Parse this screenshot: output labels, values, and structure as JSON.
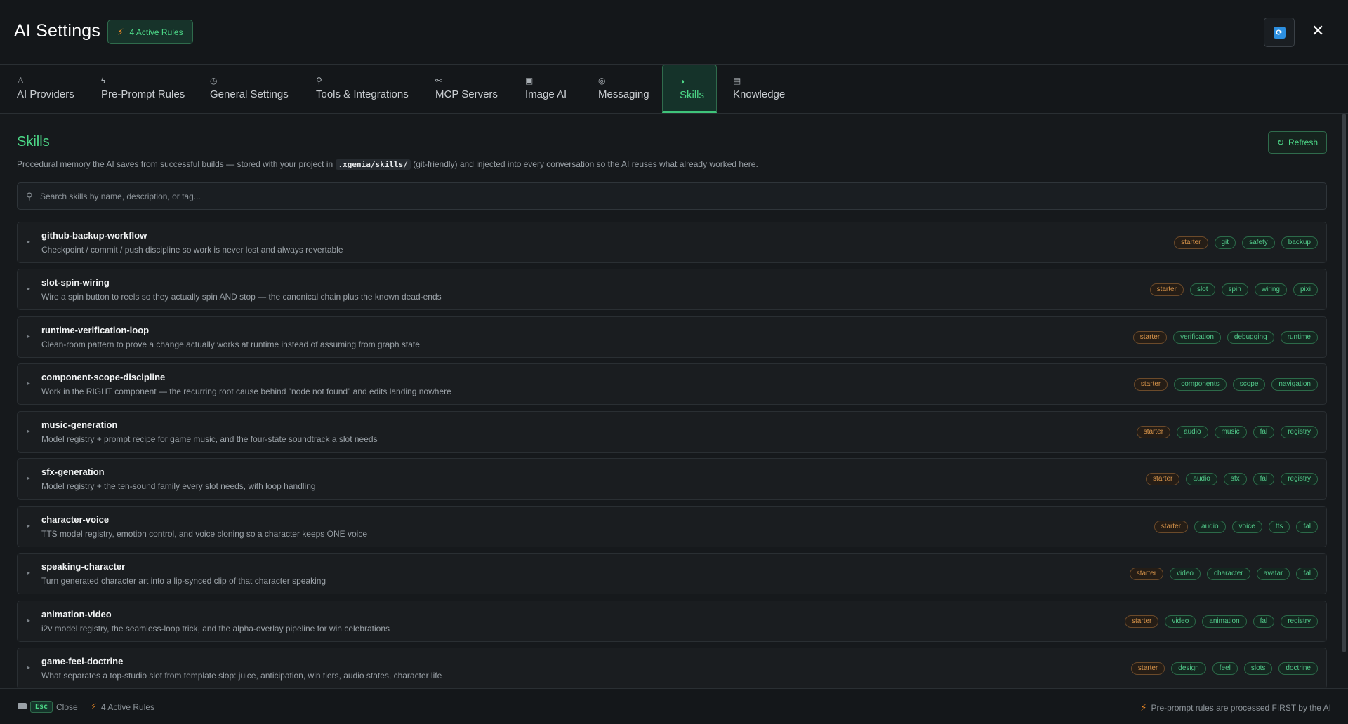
{
  "header": {
    "title": "AI Settings",
    "active_rules": "4 Active Rules",
    "sync_icon": "sync-icon",
    "close_icon": "close-icon"
  },
  "tabs": [
    {
      "label": "AI Providers",
      "icon": "user-icon"
    },
    {
      "label": "Pre-Prompt Rules",
      "icon": "bolt-icon"
    },
    {
      "label": "General Settings",
      "icon": "gear-icon"
    },
    {
      "label": "Tools & Integrations",
      "icon": "wrench-icon"
    },
    {
      "label": "MCP Servers",
      "icon": "plug-icon"
    },
    {
      "label": "Image AI",
      "icon": "image-icon"
    },
    {
      "label": "Messaging",
      "icon": "chat-icon"
    },
    {
      "label": "Skills",
      "icon": "brain-icon",
      "active": true
    },
    {
      "label": "Knowledge",
      "icon": "book-icon"
    }
  ],
  "skills_page": {
    "title": "Skills",
    "refresh_label": "Refresh",
    "desc_before": "Procedural memory the AI saves from successful builds — stored with your project in ",
    "desc_code": ".xgenia/skills/",
    "desc_after": " (git-friendly) and injected into every conversation so the AI reuses what already worked here.",
    "search_placeholder": "Search skills by name, description, or tag..."
  },
  "skills": [
    {
      "name": "github-backup-workflow",
      "description": "Checkpoint / commit / push discipline so work is never lost and always revertable",
      "tags": [
        "starter",
        "git",
        "safety",
        "backup"
      ]
    },
    {
      "name": "slot-spin-wiring",
      "description": "Wire a spin button to reels so they actually spin AND stop — the canonical chain plus the known dead-ends",
      "tags": [
        "starter",
        "slot",
        "spin",
        "wiring",
        "pixi"
      ]
    },
    {
      "name": "runtime-verification-loop",
      "description": "Clean-room pattern to prove a change actually works at runtime instead of assuming from graph state",
      "tags": [
        "starter",
        "verification",
        "debugging",
        "runtime"
      ]
    },
    {
      "name": "component-scope-discipline",
      "description": "Work in the RIGHT component — the recurring root cause behind \"node not found\" and edits landing nowhere",
      "tags": [
        "starter",
        "components",
        "scope",
        "navigation"
      ]
    },
    {
      "name": "music-generation",
      "description": "Model registry + prompt recipe for game music, and the four-state soundtrack a slot needs",
      "tags": [
        "starter",
        "audio",
        "music",
        "fal",
        "registry"
      ]
    },
    {
      "name": "sfx-generation",
      "description": "Model registry + the ten-sound family every slot needs, with loop handling",
      "tags": [
        "starter",
        "audio",
        "sfx",
        "fal",
        "registry"
      ]
    },
    {
      "name": "character-voice",
      "description": "TTS model registry, emotion control, and voice cloning so a character keeps ONE voice",
      "tags": [
        "starter",
        "audio",
        "voice",
        "tts",
        "fal"
      ]
    },
    {
      "name": "speaking-character",
      "description": "Turn generated character art into a lip-synced clip of that character speaking",
      "tags": [
        "starter",
        "video",
        "character",
        "avatar",
        "fal"
      ]
    },
    {
      "name": "animation-video",
      "description": "i2v model registry, the seamless-loop trick, and the alpha-overlay pipeline for win celebrations",
      "tags": [
        "starter",
        "video",
        "animation",
        "fal",
        "registry"
      ]
    },
    {
      "name": "game-feel-doctrine",
      "description": "What separates a top-studio slot from template slop: juice, anticipation, win tiers, audio states, character life",
      "tags": [
        "starter",
        "design",
        "feel",
        "slots",
        "doctrine"
      ]
    }
  ],
  "footer": {
    "esc_key": "Esc",
    "close_label": "Close",
    "active_rules": "4 Active Rules",
    "note": "Pre-prompt rules are processed FIRST by the AI"
  },
  "colors": {
    "accent": "#4cd787",
    "warning": "#f08a24",
    "background": "#16191c"
  }
}
